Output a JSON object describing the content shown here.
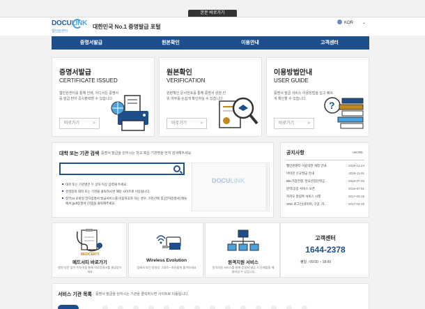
{
  "top": {
    "skip_label": "본문 바로가기"
  },
  "header": {
    "logo_text_a": "DOCU",
    "logo_text_b": "LINK",
    "logo_sub": "웹민원센터",
    "tagline": "대한민국 No.1 증명발급 포털",
    "language": "KOR"
  },
  "nav": {
    "items": [
      {
        "label": "증명서발급"
      },
      {
        "label": "원본확인"
      },
      {
        "label": "이용안내"
      },
      {
        "label": "고객센터"
      }
    ]
  },
  "cards": [
    {
      "title_ko": "증명서발급",
      "title_en": "CERTIFICATE ISSUED",
      "desc": "웹민원센터를 통해 언제, 어디서든 증명서를 발급 받아 즉시출력할 수 있습니다.",
      "button": "바로가기",
      "icon": "printer-globe-icon"
    },
    {
      "title_ko": "원본확인",
      "title_en": "VERIFICATION",
      "desc": "원본확인 문서번호를 통해 증명서 원본 진위 여부를 손쉽게 확인하실 수 있습니다.",
      "button": "바로가기",
      "icon": "certificate-magnifier-icon"
    },
    {
      "title_ko": "이용방법안내",
      "title_en": "USER GUIDE",
      "desc": "증명서 발급 서비스 이용방법을 쉽고 빠르게 확인할 수 있습니다.",
      "button": "바로가기",
      "icon": "books-question-icon"
    }
  ],
  "search": {
    "title": "대학 또는 기관 검색",
    "subtitle": "증명서 발급을 원하시는 학교 혹은 기관명을 먼저 검색해주세요.",
    "input_value": "",
    "info": [
      "대학 또는 기관명은 두 글자 이상 입력해 주세요.",
      "검색창의 대학 또는 기관을 클릭하시면 해당 사이트로 이동됩니다.",
      "정부24 모바일 전자증명서 발급서비스를 이용하고자 하는 경우, 기관선택 후 [전자증명서] 메뉴에서 [pdf증명서 신청]을 클릭해주세요."
    ],
    "watermark_a": "DOCU",
    "watermark_b": "LINK"
  },
  "notice": {
    "title": "공지사항",
    "more": "+MORE",
    "items": [
      {
        "title": "웹민원센터 이용약관 개정 안내",
        "date": "2019-12-24"
      },
      {
        "title": "마이한 신규발급 안내",
        "date": "2019-11-01"
      },
      {
        "title": "IBK기업은행, 한국산업인력공...",
        "date": "2018-07-20"
      },
      {
        "title": "번역/공증 서비스 오픈",
        "date": "2018-07-01"
      },
      {
        "title": "카카오 알림톡 서비스 시행",
        "date": "2017-03-16"
      },
      {
        "title": "SNS 로그인(네이버, 구글, 카...",
        "date": "2017-03-16"
      }
    ]
  },
  "services": [
    {
      "sub": "MEDCERTI",
      "name": "메드서티 바로가기",
      "desc": "병원 방문 없이 인터넷을 통해 의료증명서를 발급받으세요",
      "icon": "stethoscope-clipboard-icon"
    },
    {
      "sub": "",
      "name": "Wireless Evolution",
      "desc": "집에서 보던 동영상 그대로~ 자유롭게 즐겨보세요",
      "icon": "wireless-usb-icon"
    },
    {
      "sub": "",
      "name": "원격지원 서비스",
      "desc": "원격지원 서비스를 통해 증명서 발급 시 문제점을 해결하실 수 있습니다",
      "icon": "remote-network-icon"
    }
  ],
  "customer_center": {
    "title": "고객센터",
    "phone": "1644-2378",
    "hours": "평일 : 09:00 ~ 18:00"
  },
  "institutions": {
    "title": "서비스 기관 목록",
    "subtitle": "증명서 발급을 원하시는 기관을 클릭하시면 사이트로 이동됩니다."
  },
  "colors": {
    "brand_navy": "#1e4e8c",
    "brand_light": "#4aa3df",
    "accent_gold": "#c08a1e"
  }
}
